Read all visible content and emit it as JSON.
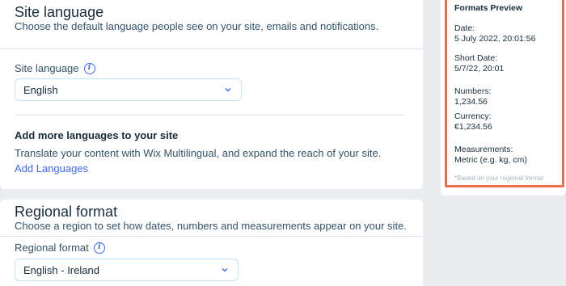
{
  "site_language": {
    "title": "Site language",
    "subtitle": "Choose the default language people see on your site, emails and notifications.",
    "field_label": "Site language",
    "selected": "English",
    "add_more_title": "Add more languages to your site",
    "add_more_text": "Translate your content with Wix Multilingual, and expand the reach of your site.",
    "add_link": "Add Languages"
  },
  "regional_format": {
    "title": "Regional format",
    "subtitle": "Choose a region to set how dates, numbers and measurements appear on your site.",
    "field_label": "Regional format",
    "selected": "English - Ireland"
  },
  "preview": {
    "title": "Formats Preview",
    "date_label": "Date:",
    "date_value": "5 July 2022, 20:01:56",
    "short_date_label": "Short Date:",
    "short_date_value": "5/7/22, 20:01",
    "numbers_label": "Numbers:",
    "numbers_value": "1,234.56",
    "currency_label": "Currency:",
    "currency_value": "€1,234.56",
    "measurements_label": "Measurements:",
    "measurements_value": "Metric (e.g. kg, cm)",
    "note": "*Based on your regional format"
  },
  "icons": {
    "info": "info-icon",
    "chevron": "chevron-down-icon"
  },
  "colors": {
    "accent": "#3b68ff",
    "highlight_border": "#ee6b4b",
    "background": "#eaecef"
  }
}
